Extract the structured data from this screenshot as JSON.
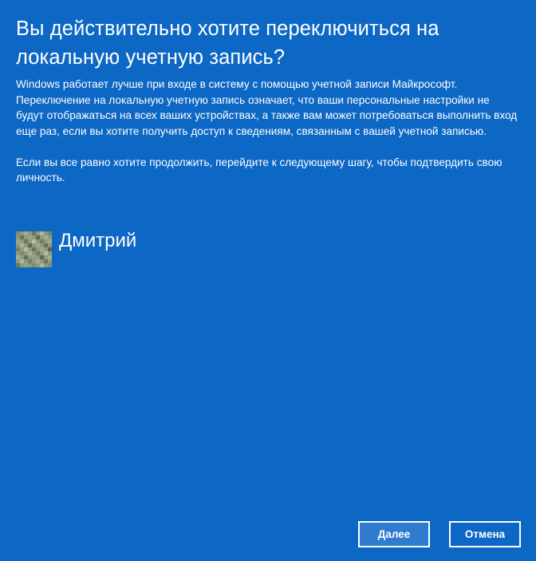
{
  "dialog": {
    "title": "Вы действительно хотите переключиться на локальную учетную запись?",
    "paragraph1": "Windows работает лучше при входе в систему с помощью учетной записи Майкрософт. Переключение на локальную учетную запись означает, что ваши персональные настройки не будут отображаться на всех ваших устройствах, а также вам может потребоваться выполнить вход еще раз, если вы хотите получить доступ к сведениям, связанным с вашей учетной записью.",
    "paragraph2": "Если вы все равно хотите продолжить, перейдите к следующему шагу, чтобы подтвердить свою личность."
  },
  "user": {
    "name": "Дмитрий",
    "avatar_icon": "user-avatar-pixelated"
  },
  "buttons": {
    "next_label": "Далее",
    "cancel_label": "Отмена"
  },
  "colors": {
    "background": "#0d67c4",
    "text": "#ffffff",
    "next_button_fill": "#2f7bd0"
  }
}
